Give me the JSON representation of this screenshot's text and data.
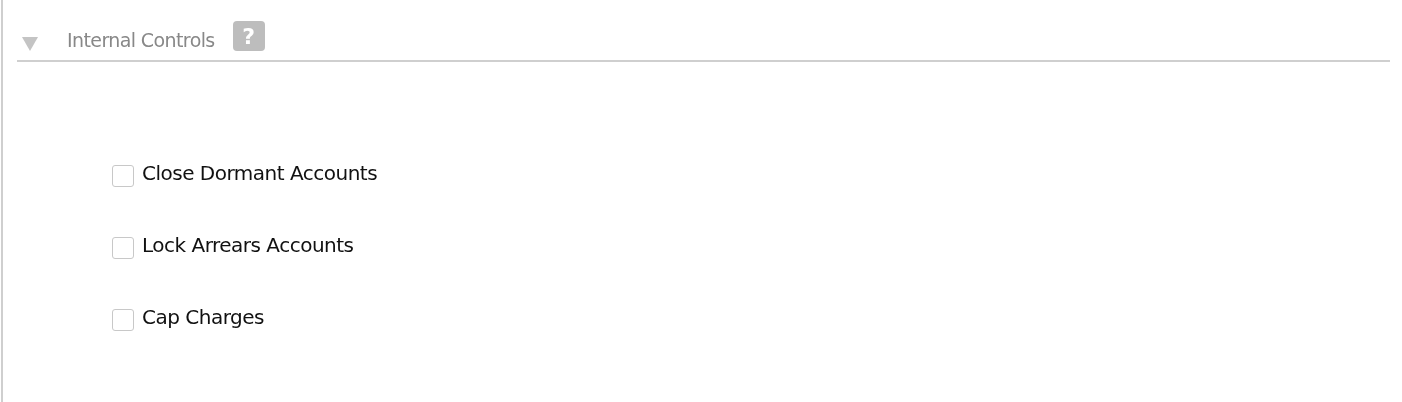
{
  "section": {
    "title": "Internal Controls",
    "expanded": true,
    "help": "?"
  },
  "options": [
    {
      "label": "Close Dormant Accounts",
      "checked": false
    },
    {
      "label": "Lock Arrears Accounts",
      "checked": false
    },
    {
      "label": "Cap Charges",
      "checked": false
    }
  ]
}
